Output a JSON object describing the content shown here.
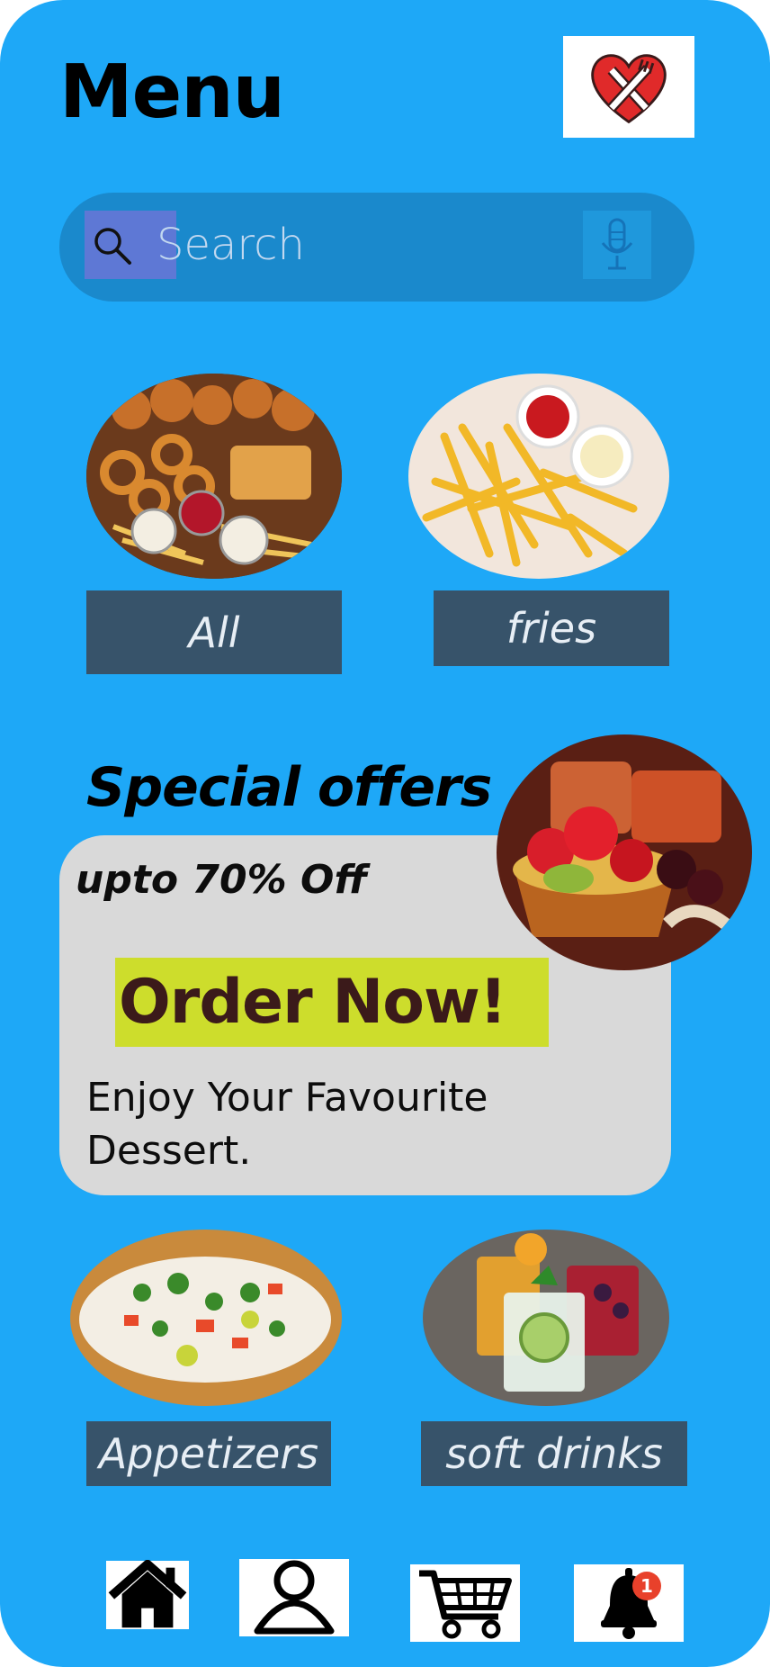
{
  "header": {
    "title": "Menu",
    "logo_icon": "heart-fork-knife-logo"
  },
  "search": {
    "placeholder": "Search",
    "icon": "search-icon",
    "mic_icon": "microphone-icon"
  },
  "categories_top": [
    {
      "label": "All",
      "image": "mixed-fried-platter"
    },
    {
      "label": "fries",
      "image": "french-fries-with-dips"
    }
  ],
  "special_offers": {
    "heading": "Special offers",
    "discount": "upto 70% Off",
    "cta_label": "Order Now!",
    "description": "Enjoy Your Favourite Dessert.",
    "image": "fruit-tart-dessert"
  },
  "categories_bottom": [
    {
      "label": "Appetizers",
      "image": "bruschetta-appetizers"
    },
    {
      "label": "soft drinks",
      "image": "cold-drinks-glasses"
    }
  ],
  "bottom_nav": {
    "items": [
      {
        "icon": "home-icon"
      },
      {
        "icon": "profile-icon"
      },
      {
        "icon": "cart-icon"
      },
      {
        "icon": "bell-icon",
        "badge": "1"
      }
    ]
  },
  "colors": {
    "background": "#1ea8f7",
    "search_bar": "#1a89cc",
    "label_bg": "#37536a",
    "card_bg": "#d9d9d9",
    "cta_bg": "#cddd2c",
    "badge": "#e8412b"
  }
}
